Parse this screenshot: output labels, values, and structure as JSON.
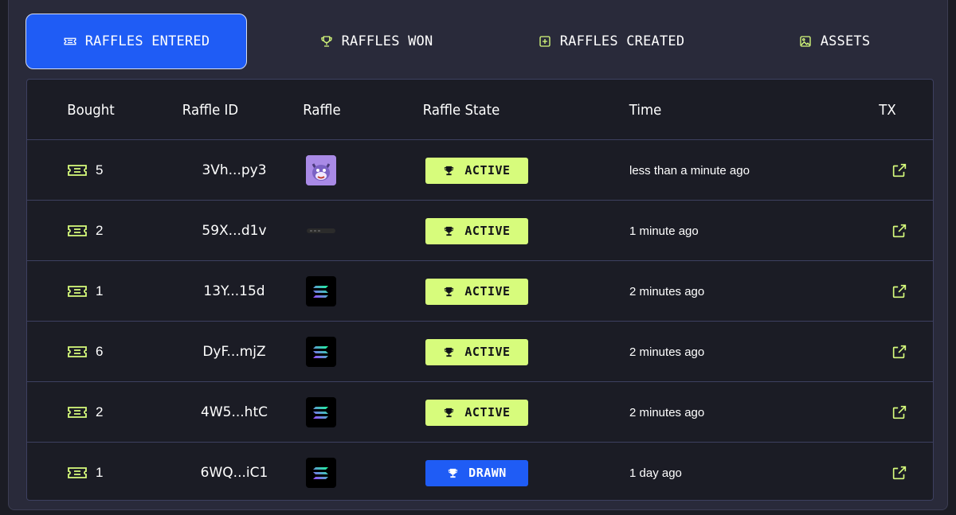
{
  "colors": {
    "accent_blue": "#1f5cf5",
    "accent_green": "#d7fc7c",
    "panel_bg": "#292a3a",
    "table_bg": "#1b1c25"
  },
  "tabs": [
    {
      "label": "RAFFLES ENTERED",
      "icon": "ticket-icon",
      "active": true
    },
    {
      "label": "RAFFLES WON",
      "icon": "trophy-icon",
      "active": false
    },
    {
      "label": "RAFFLES CREATED",
      "icon": "plus-square-icon",
      "active": false
    },
    {
      "label": "ASSETS",
      "icon": "image-icon",
      "active": false
    }
  ],
  "table": {
    "headers": {
      "bought": "Bought",
      "raffle_id": "Raffle ID",
      "raffle": "Raffle",
      "state": "Raffle State",
      "time": "Time",
      "tx": "TX"
    },
    "rows": [
      {
        "bought": "5",
        "raffle_id": "3Vh...py3",
        "image": "cat-nft-thumbnail",
        "state": "ACTIVE",
        "time": "less than a minute ago"
      },
      {
        "bought": "2",
        "raffle_id": "59X...d1v",
        "image": "device-bar-thumbnail",
        "state": "ACTIVE",
        "time": "1 minute ago"
      },
      {
        "bought": "1",
        "raffle_id": "13Y...15d",
        "image": "solana-logo-thumbnail",
        "state": "ACTIVE",
        "time": "2 minutes ago"
      },
      {
        "bought": "6",
        "raffle_id": "DyF...mjZ",
        "image": "solana-logo-thumbnail",
        "state": "ACTIVE",
        "time": "2 minutes ago"
      },
      {
        "bought": "2",
        "raffle_id": "4W5...htC",
        "image": "solana-logo-thumbnail",
        "state": "ACTIVE",
        "time": "2 minutes ago"
      },
      {
        "bought": "1",
        "raffle_id": "6WQ...iC1",
        "image": "solana-logo-thumbnail",
        "state": "DRAWN",
        "time": "1 day ago"
      }
    ]
  }
}
